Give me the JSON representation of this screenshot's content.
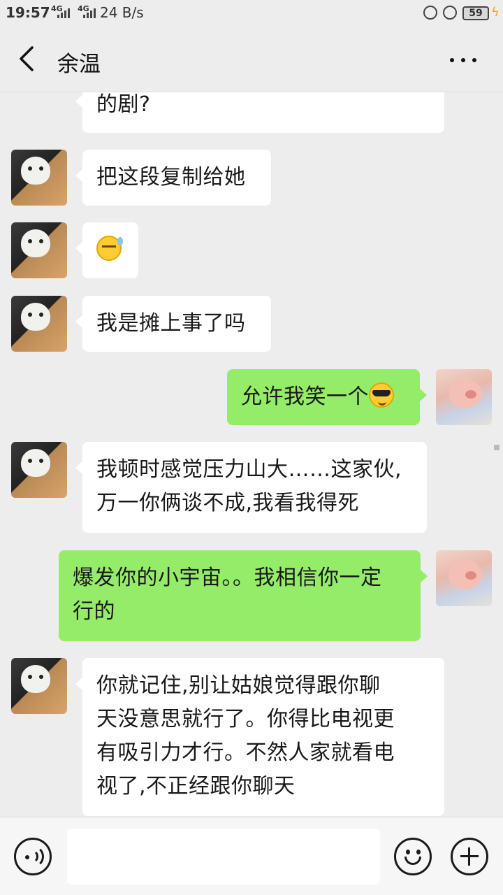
{
  "status_bar": {
    "time": "19:57",
    "signal1": "4G",
    "signal2": "4G",
    "net_speed": "24 B/s",
    "battery": "59"
  },
  "header": {
    "title": "余温"
  },
  "messages": [
    {
      "side": "in",
      "avatar": "cat-avatar",
      "lines": [
        "的剧?"
      ]
    },
    {
      "side": "in",
      "avatar": "cat-avatar",
      "lines": [
        "把这段复制给她"
      ]
    },
    {
      "side": "in",
      "avatar": "cat-avatar",
      "emoji": "sweat-emoji"
    },
    {
      "side": "in",
      "avatar": "cat-avatar",
      "lines": [
        "我是摊上事了吗"
      ]
    },
    {
      "side": "out",
      "avatar": "pig-avatar",
      "lines": [
        "允许我笑一个"
      ],
      "emoji": "sunglasses-emoji"
    },
    {
      "side": "in",
      "avatar": "cat-avatar",
      "lines": [
        "我顿时感觉压力山大……这家伙,",
        "万一你俩谈不成,我看我得死"
      ]
    },
    {
      "side": "out",
      "avatar": "pig-avatar",
      "lines": [
        "爆发你的小宇宙。。我相信你一定",
        "行的"
      ]
    },
    {
      "side": "in",
      "avatar": "cat-avatar",
      "lines": [
        "你就记住,别让姑娘觉得跟你聊",
        "天没意思就行了。你得比电视更",
        "有吸引力才行。不然人家就看电",
        "视了,不正经跟你聊天"
      ]
    }
  ],
  "input_bar": {
    "value": "",
    "icons": [
      "voice-icon",
      "emoji-icon",
      "plus-icon"
    ]
  },
  "colors": {
    "background": "#ededed",
    "incoming_bubble": "#ffffff",
    "outgoing_bubble": "#95ec69"
  }
}
